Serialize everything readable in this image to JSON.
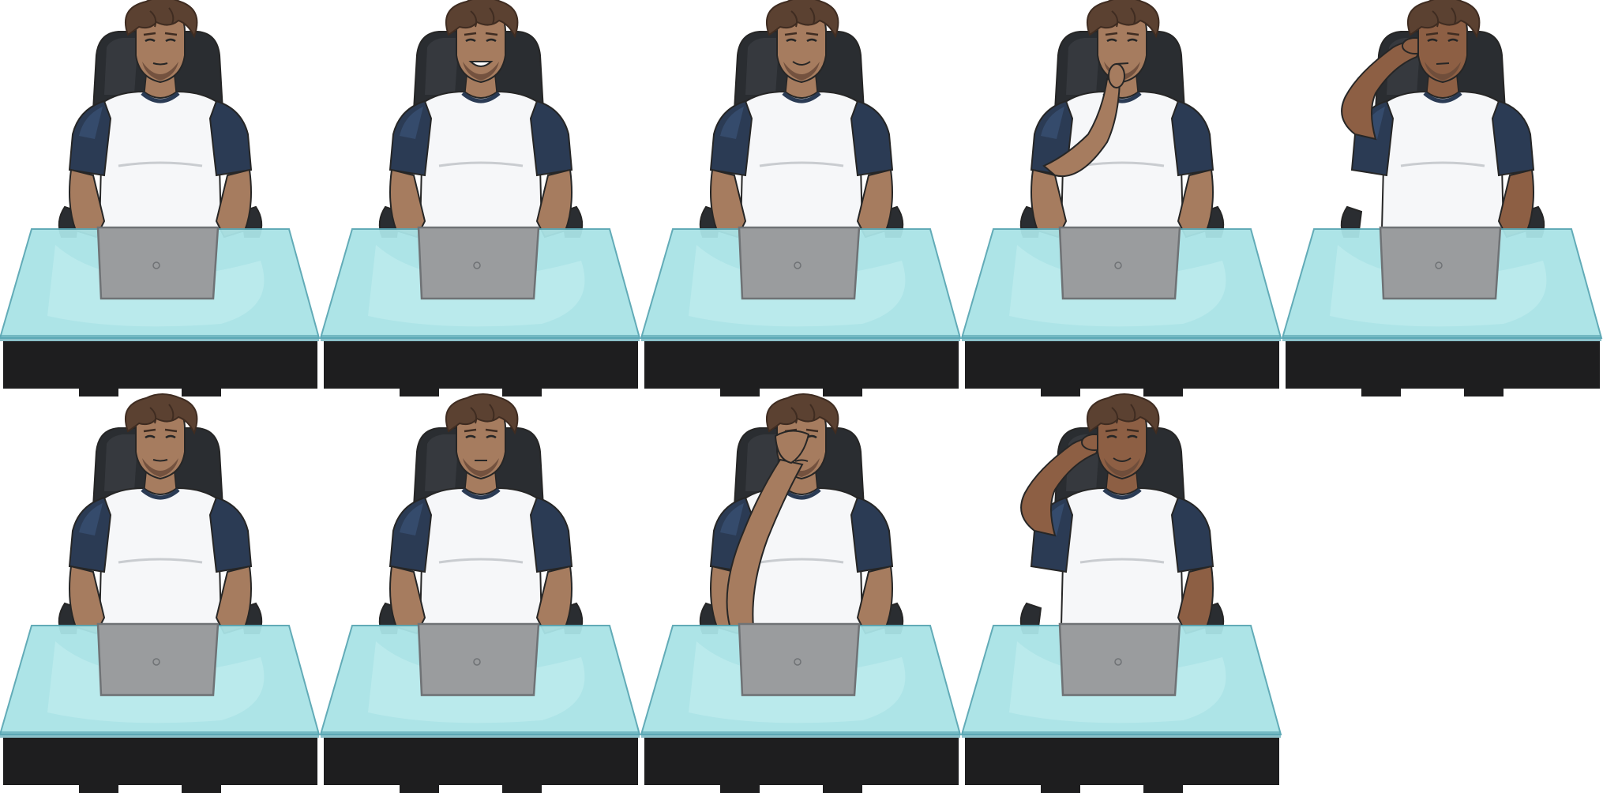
{
  "sheet": {
    "kind": "character-sprite-sheet",
    "rows": 2,
    "columns": 5,
    "background": "#ffffff"
  },
  "colors": {
    "skin": "#a67c5f",
    "skin_shadow": "#8a6249",
    "skin_dark": "#8d5f44",
    "hair": "#5b4131",
    "hair_dark": "#3f2c21",
    "beard": "#6b4b39",
    "shirt_body": "#f6f7f9",
    "shirt_sleeve": "#2b3b54",
    "shirt_sleeve_light": "#3a5376",
    "chair": "#2a2d31",
    "chair_light": "#3f4348",
    "desk_top": "#a9e3e6",
    "desk_top_light": "#c4eef0",
    "desk_edge": "#5aa7b4",
    "desk_base": "#1e1e1f",
    "laptop": "#9a9c9e",
    "laptop_edge": "#6f7275",
    "outline": "#262626"
  },
  "poses": [
    {
      "id": 1,
      "pose": "hands-on-laptop",
      "expression": "neutral",
      "skin_tone": "skin"
    },
    {
      "id": 2,
      "pose": "hands-on-laptop",
      "expression": "grin",
      "skin_tone": "skin"
    },
    {
      "id": 3,
      "pose": "hands-on-laptop",
      "expression": "smile",
      "skin_tone": "skin"
    },
    {
      "id": 4,
      "pose": "hand-to-chin",
      "expression": "thinking",
      "skin_tone": "skin"
    },
    {
      "id": 5,
      "pose": "hand-to-forehead",
      "expression": "thinking",
      "skin_tone": "skin_dark"
    },
    {
      "id": 6,
      "pose": "hands-on-laptop",
      "expression": "neutral",
      "skin_tone": "skin"
    },
    {
      "id": 7,
      "pose": "hands-on-laptop",
      "expression": "serious",
      "skin_tone": "skin"
    },
    {
      "id": 8,
      "pose": "facepalm",
      "expression": "tired",
      "skin_tone": "skin"
    },
    {
      "id": 9,
      "pose": "hand-to-forehead",
      "expression": "smile",
      "skin_tone": "skin_dark"
    }
  ]
}
